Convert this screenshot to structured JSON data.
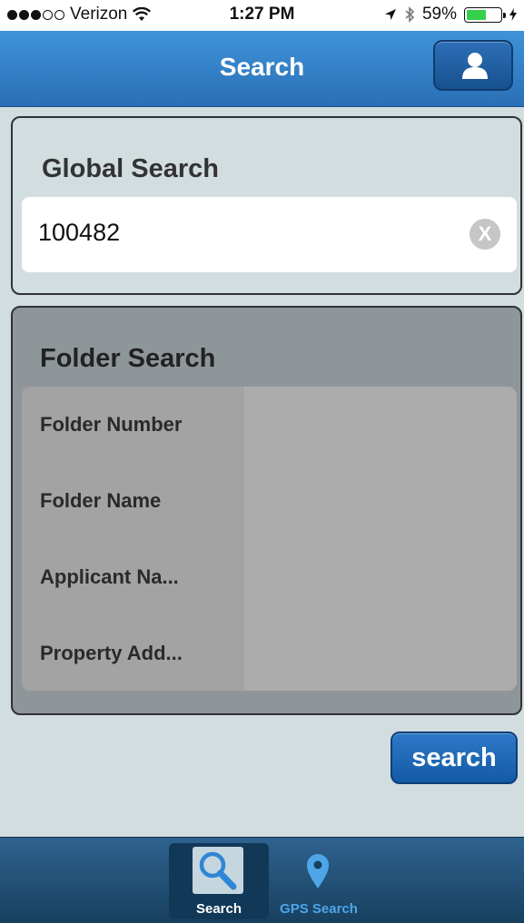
{
  "status_bar": {
    "carrier": "Verizon",
    "signal_bars_filled": 3,
    "signal_bars_total": 5,
    "wifi_icon": "wifi-icon",
    "time": "1:27 PM",
    "location_icon": "location-arrow-icon",
    "bluetooth_icon": "bluetooth-icon",
    "battery_percent": "59%",
    "battery_level": 0.59,
    "charging_icon": "bolt-icon"
  },
  "nav": {
    "title": "Search",
    "profile_icon": "user-icon"
  },
  "global_search": {
    "title": "Global Search",
    "value": "100482",
    "clear_label": "X"
  },
  "folder_search": {
    "title": "Folder Search",
    "fields": [
      {
        "label": "Folder Number",
        "value": ""
      },
      {
        "label": "Folder Name",
        "value": ""
      },
      {
        "label": "Applicant Na...",
        "value": ""
      },
      {
        "label": "Property Add...",
        "value": ""
      }
    ]
  },
  "search_button": {
    "label": "search"
  },
  "tab_bar": {
    "tabs": [
      {
        "label": "Search",
        "icon": "magnifier-icon",
        "active": true
      },
      {
        "label": "GPS Search",
        "icon": "map-pin-icon",
        "active": false
      }
    ]
  },
  "colors": {
    "nav_blue": "#3a87d0",
    "background": "#d2dde0",
    "tab_bar": "#234f76",
    "battery_green": "#35d04a"
  }
}
